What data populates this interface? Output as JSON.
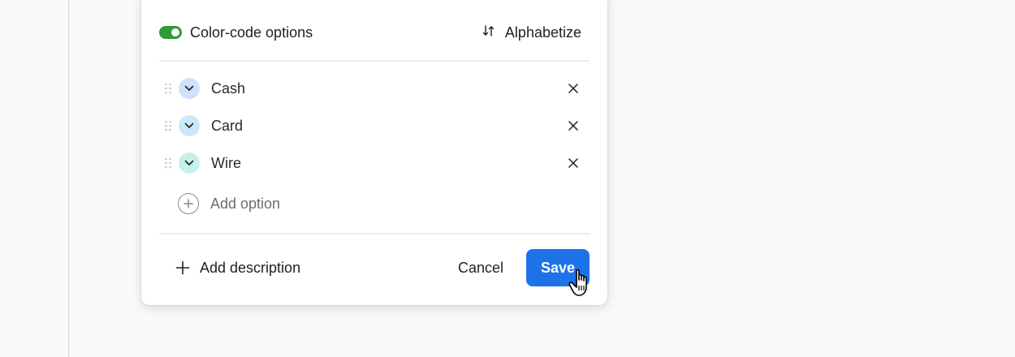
{
  "settings": {
    "color_code_label": "Color-code options",
    "color_code_on": true,
    "alphabetize_label": "Alphabetize",
    "alphabetize_icon": "sort-arrows-icon"
  },
  "options": [
    {
      "label": "Cash",
      "color": "#cfe0fb"
    },
    {
      "label": "Card",
      "color": "#c9e9f8"
    },
    {
      "label": "Wire",
      "color": "#c6f1ea"
    }
  ],
  "add_option_label": "Add option",
  "footer": {
    "add_description_label": "Add description",
    "cancel_label": "Cancel",
    "save_label": "Save"
  },
  "colors": {
    "toggle_on": "#2d9b3a",
    "save_button": "#1d72e8"
  }
}
